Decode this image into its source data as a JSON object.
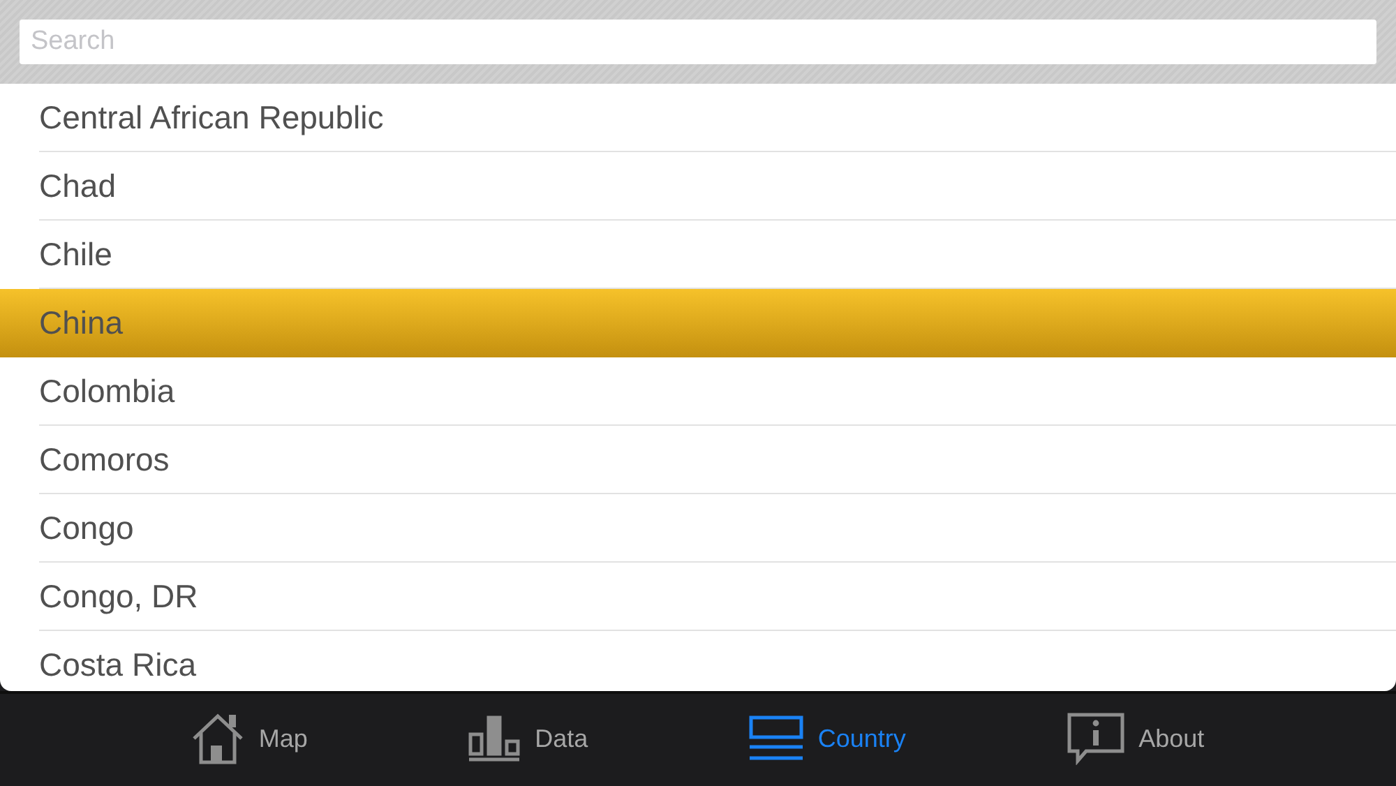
{
  "search": {
    "placeholder": "Search"
  },
  "countries": [
    {
      "name": "Central African Republic",
      "selected": false
    },
    {
      "name": "Chad",
      "selected": false
    },
    {
      "name": "Chile",
      "selected": false
    },
    {
      "name": "China",
      "selected": true
    },
    {
      "name": "Colombia",
      "selected": false
    },
    {
      "name": "Comoros",
      "selected": false
    },
    {
      "name": "Congo",
      "selected": false
    },
    {
      "name": "Congo, DR",
      "selected": false
    },
    {
      "name": "Costa Rica",
      "selected": false
    }
  ],
  "tabs": [
    {
      "kind": "map",
      "label": "Map",
      "selected": false
    },
    {
      "kind": "data",
      "label": "Data",
      "selected": false
    },
    {
      "kind": "country",
      "label": "Country",
      "selected": true
    },
    {
      "kind": "about",
      "label": "About",
      "selected": false
    }
  ]
}
